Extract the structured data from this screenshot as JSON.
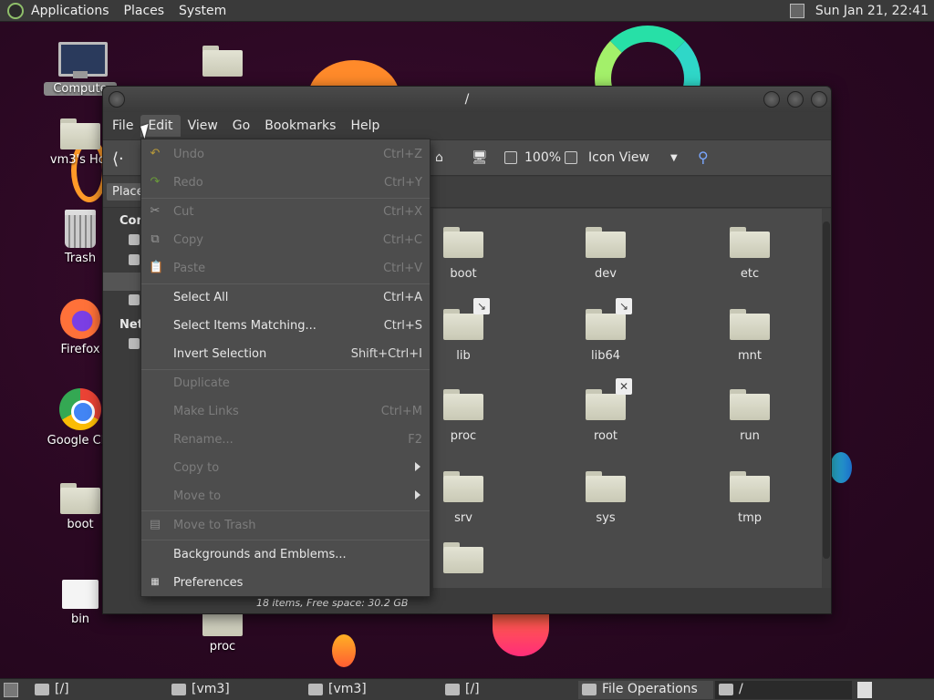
{
  "top_panel": {
    "menus": [
      "Applications",
      "Places",
      "System"
    ],
    "clock": "Sun Jan 21, 22:41"
  },
  "desktop": {
    "icons": [
      {
        "label": "Compute",
        "icon": "computer-icon"
      },
      {
        "label": "vm3's Hor",
        "icon": "home-folder-icon"
      },
      {
        "label": "Trash",
        "icon": "trash-icon"
      },
      {
        "label": "Firefox",
        "icon": "firefox-icon"
      },
      {
        "label": "Google Chr",
        "icon": "chrome-icon"
      },
      {
        "label": "boot",
        "icon": "folder-icon"
      },
      {
        "label": "bin",
        "icon": "file-icon"
      },
      {
        "label": "proc",
        "icon": "folder-icon"
      }
    ]
  },
  "window": {
    "title": "/",
    "menubar": [
      "File",
      "Edit",
      "View",
      "Go",
      "Bookmarks",
      "Help"
    ],
    "active_menu": "Edit",
    "toolbar": {
      "zoom": "100%",
      "view_mode": "Icon View"
    },
    "places_label": "Places",
    "sidebar": {
      "sections": [
        "Com",
        "Netw"
      ]
    },
    "files": [
      {
        "name": "boot",
        "emblem": ""
      },
      {
        "name": "dev",
        "emblem": ""
      },
      {
        "name": "etc",
        "emblem": ""
      },
      {
        "name": "lib",
        "emblem": "↘"
      },
      {
        "name": "lib64",
        "emblem": "↘"
      },
      {
        "name": "mnt",
        "emblem": ""
      },
      {
        "name": "proc",
        "emblem": ""
      },
      {
        "name": "root",
        "emblem": "✕"
      },
      {
        "name": "run",
        "emblem": ""
      },
      {
        "name": "srv",
        "emblem": ""
      },
      {
        "name": "sys",
        "emblem": ""
      },
      {
        "name": "tmp",
        "emblem": ""
      },
      {
        "name": "",
        "emblem": ""
      }
    ],
    "status": "18 items, Free space: 30.2 GB"
  },
  "edit_menu": {
    "items": [
      {
        "label": "Undo",
        "accel": "Ctrl+Z",
        "disabled": true,
        "icon": "undo-icon"
      },
      {
        "label": "Redo",
        "accel": "Ctrl+Y",
        "disabled": true,
        "icon": "redo-icon"
      },
      {
        "label": "Cut",
        "accel": "Ctrl+X",
        "disabled": true,
        "icon": "cut-icon"
      },
      {
        "label": "Copy",
        "accel": "Ctrl+C",
        "disabled": true,
        "icon": "copy-icon"
      },
      {
        "label": "Paste",
        "accel": "Ctrl+V",
        "disabled": true,
        "icon": "paste-icon"
      },
      {
        "label": "Select All",
        "accel": "Ctrl+A",
        "disabled": false,
        "icon": ""
      },
      {
        "label": "Select Items Matching...",
        "accel": "Ctrl+S",
        "disabled": false,
        "icon": ""
      },
      {
        "label": "Invert Selection",
        "accel": "Shift+Ctrl+I",
        "disabled": false,
        "icon": ""
      },
      {
        "label": "Duplicate",
        "accel": "",
        "disabled": true,
        "icon": ""
      },
      {
        "label": "Make Links",
        "accel": "Ctrl+M",
        "disabled": true,
        "icon": ""
      },
      {
        "label": "Rename...",
        "accel": "F2",
        "disabled": true,
        "icon": ""
      },
      {
        "label": "Copy to",
        "accel": "",
        "disabled": true,
        "icon": "",
        "submenu": true
      },
      {
        "label": "Move to",
        "accel": "",
        "disabled": true,
        "icon": "",
        "submenu": true
      },
      {
        "label": "Move to Trash",
        "accel": "",
        "disabled": true,
        "icon": "trash-icon"
      },
      {
        "label": "Backgrounds and Emblems...",
        "accel": "",
        "disabled": false,
        "icon": ""
      },
      {
        "label": "Preferences",
        "accel": "",
        "disabled": false,
        "icon": "preferences-icon"
      }
    ]
  },
  "taskbar": {
    "tasks": [
      {
        "label": "[/]"
      },
      {
        "label": "[vm3]"
      },
      {
        "label": "[vm3]"
      },
      {
        "label": "[/]"
      },
      {
        "label": "File Operations"
      },
      {
        "label": "/"
      }
    ]
  }
}
